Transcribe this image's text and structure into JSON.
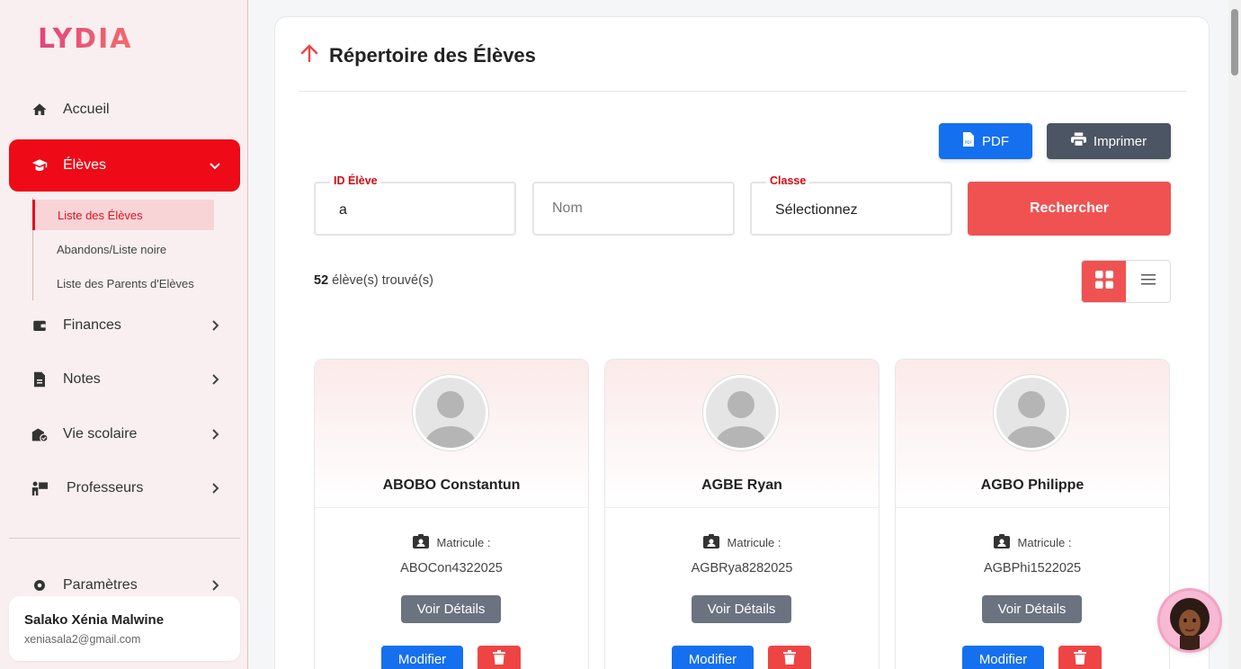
{
  "brand": {
    "logo": "LYDIA"
  },
  "sidebar": {
    "items": [
      {
        "label": "Accueil",
        "icon": "home-icon"
      },
      {
        "label": "Élèves",
        "icon": "graduate-icon"
      },
      {
        "label": "Finances",
        "icon": "wallet-icon"
      },
      {
        "label": "Notes",
        "icon": "document-icon"
      },
      {
        "label": "Vie scolaire",
        "icon": "school-icon"
      },
      {
        "label": "Professeurs",
        "icon": "teacher-icon"
      },
      {
        "label": "Paramètres",
        "icon": "settings-icon"
      }
    ],
    "sub_items": [
      {
        "label": "Liste des Élèves"
      },
      {
        "label": "Abandons/Liste noire"
      },
      {
        "label": "Liste des Parents d'Elèves"
      }
    ],
    "user": {
      "name": "Salako Xénia Malwine",
      "email": "xeniasala2@gmail.com"
    }
  },
  "main": {
    "title": "Répertoire des Élèves",
    "pdf_label": "PDF",
    "print_label": "Imprimer",
    "filters": {
      "id_label": "ID Élève",
      "id_value": "a",
      "name_placeholder": "Nom",
      "class_label": "Classe",
      "class_value": "Sélectionnez"
    },
    "search_label": "Rechercher",
    "count_number": "52",
    "count_text": "élève(s) trouvé(s)"
  },
  "students": [
    {
      "name": "ABOBO Constantun",
      "matricule_label": "Matricule :",
      "matricule": "ABOCon4322025",
      "details_label": "Voir Détails",
      "edit_label": "Modifier"
    },
    {
      "name": "AGBE Ryan",
      "matricule_label": "Matricule :",
      "matricule": "AGBRya8282025",
      "details_label": "Voir Détails",
      "edit_label": "Modifier"
    },
    {
      "name": "AGBO Philippe",
      "matricule_label": "Matricule :",
      "matricule": "AGBPhi1522025",
      "details_label": "Voir Détails",
      "edit_label": "Modifier"
    }
  ],
  "colors": {
    "accent": "#ee0a17",
    "primary": "#1570ef",
    "danger": "#f05252",
    "gray": "#4b5563"
  }
}
